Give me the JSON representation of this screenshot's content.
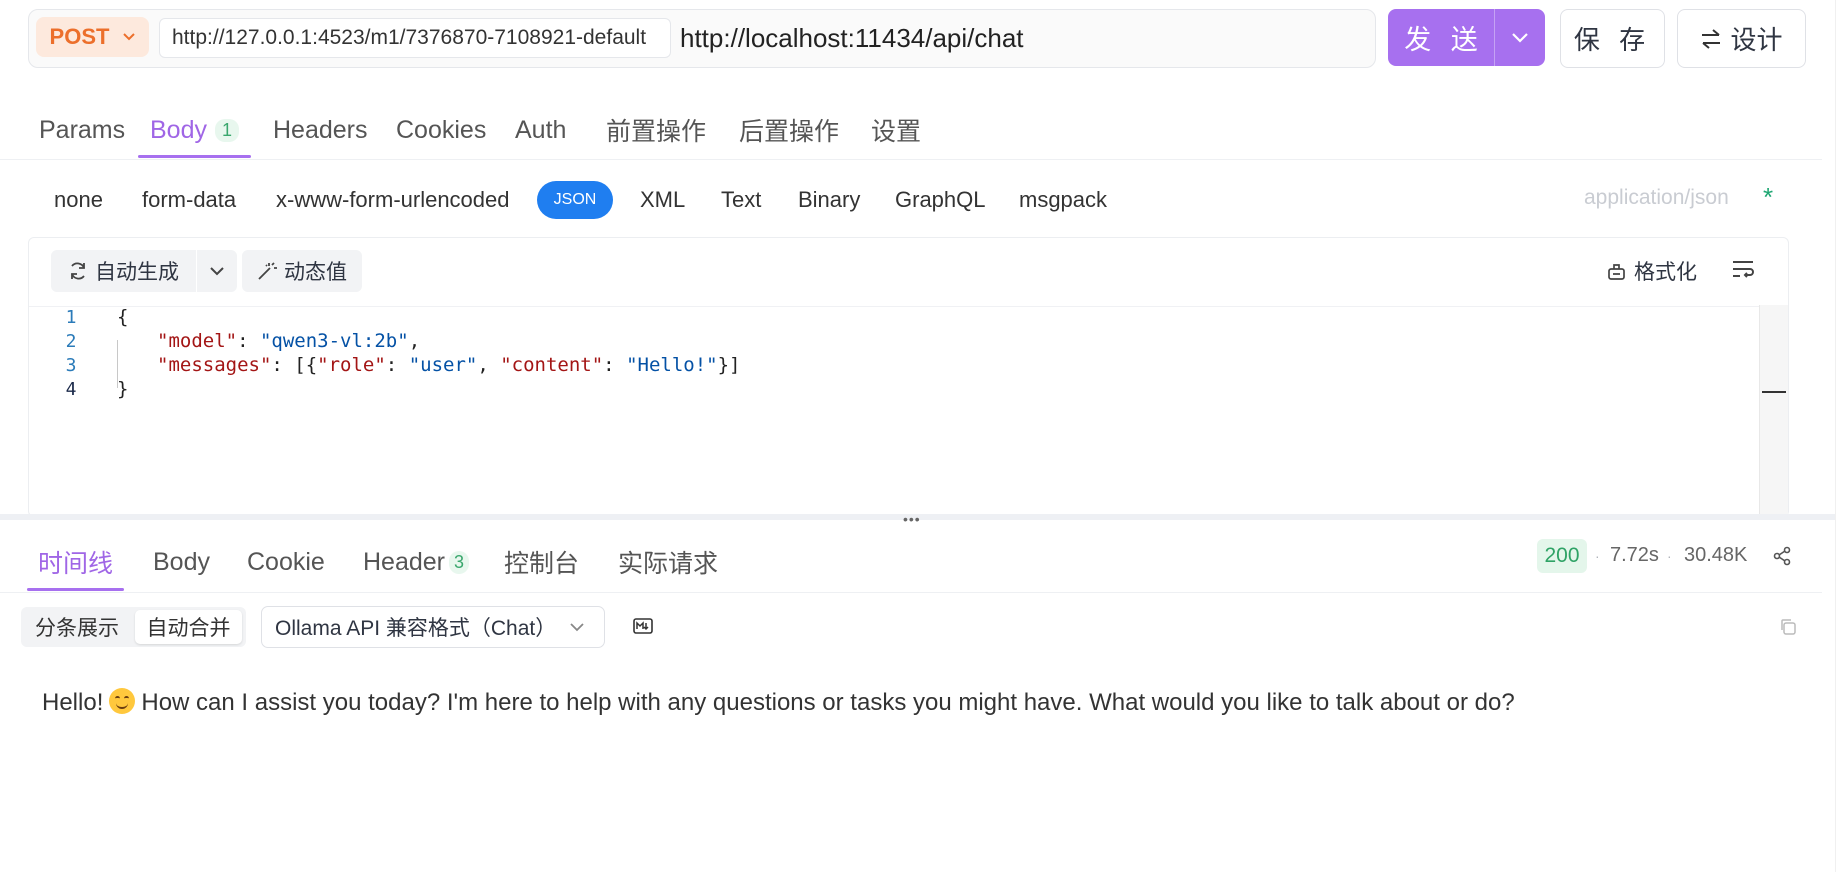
{
  "request": {
    "method": "POST",
    "env_url": "http://127.0.0.1:4523/m1/7376870-7108921-default",
    "path_url": "http://localhost:11434/api/chat",
    "send_label": "发 送",
    "save_label": "保 存",
    "design_label": "设计"
  },
  "request_tabs": [
    {
      "label": "Params"
    },
    {
      "label": "Body",
      "count": "1"
    },
    {
      "label": "Headers"
    },
    {
      "label": "Cookies"
    },
    {
      "label": "Auth"
    },
    {
      "label": "前置操作"
    },
    {
      "label": "后置操作"
    },
    {
      "label": "设置"
    }
  ],
  "body_types": [
    "none",
    "form-data",
    "x-www-form-urlencoded",
    "JSON",
    "XML",
    "Text",
    "Binary",
    "GraphQL",
    "msgpack"
  ],
  "content_type": "application/json",
  "required_mark": "*",
  "editor": {
    "autogen_label": "自动生成",
    "dynamic_label": "动态值",
    "format_label": "格式化",
    "line_numbers": [
      "1",
      "2",
      "3",
      "4"
    ],
    "code": {
      "open": "{",
      "k_model": "\"model\"",
      "v_model": "\"qwen3-vl:2b\"",
      "k_messages": "\"messages\"",
      "k_role": "\"role\"",
      "v_role": "\"user\"",
      "k_content": "\"content\"",
      "v_content": "\"Hello!\"",
      "close": "}"
    }
  },
  "response_tabs": [
    {
      "label": "时间线"
    },
    {
      "label": "Body"
    },
    {
      "label": "Cookie"
    },
    {
      "label": "Header",
      "count": "3"
    },
    {
      "label": "控制台"
    },
    {
      "label": "实际请求"
    }
  ],
  "response_meta": {
    "status": "200",
    "time": "7.72s",
    "size": "30.48K"
  },
  "response_toolbar": {
    "mode_split": "分条展示",
    "mode_merge": "自动合并",
    "format_select": "Ollama API 兼容格式（Chat）"
  },
  "response_text": {
    "before": "Hello!",
    "after": "How can I assist you today? I'm here to help with any questions or tasks you might have. What would you like to talk about or do?"
  },
  "colors": {
    "accent": "#a770ef",
    "method": "#ec6f2b",
    "json_pill": "#1f7ef0",
    "status_ok": "#2fa366"
  }
}
